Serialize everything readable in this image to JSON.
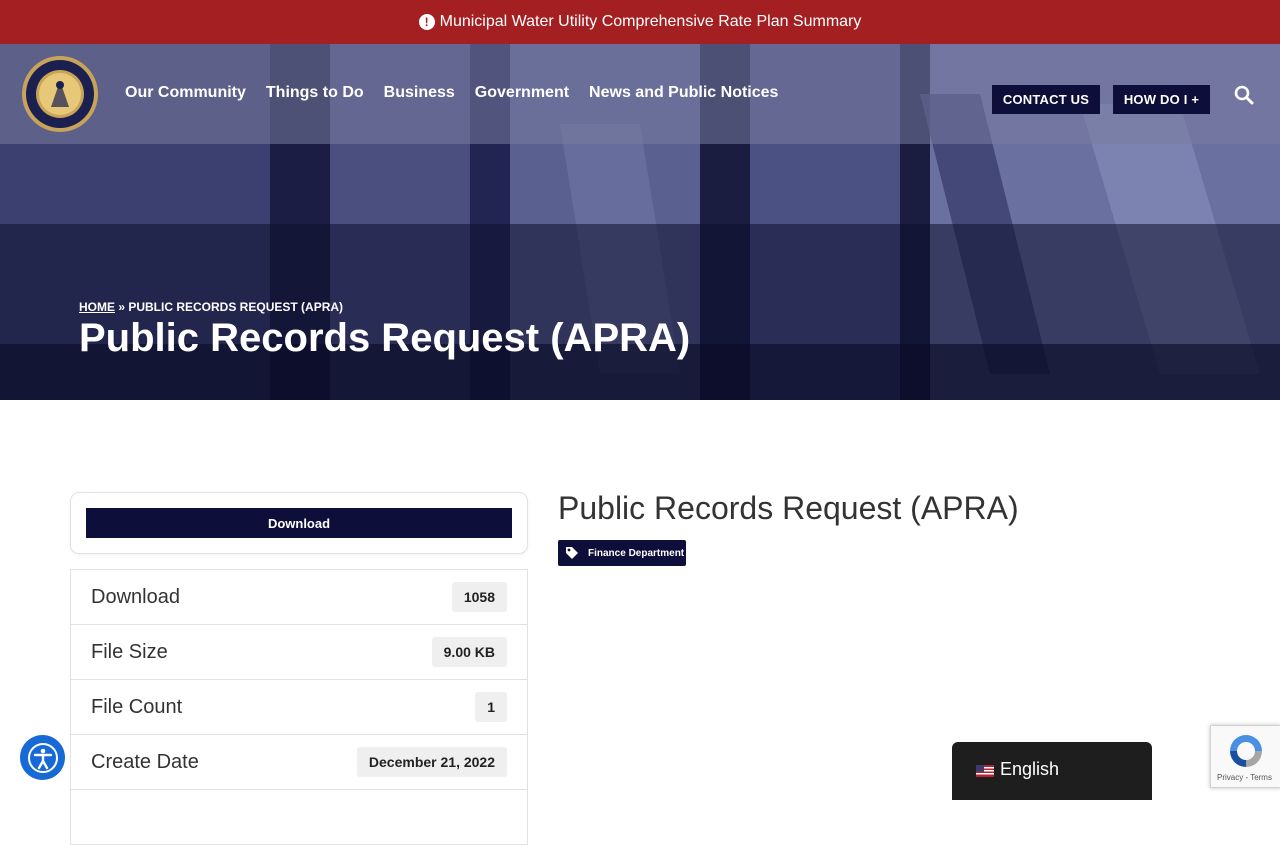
{
  "alert": {
    "icon": "exclamation-circle-icon",
    "text": "Municipal Water Utility Comprehensive Rate Plan Summary"
  },
  "header": {
    "logo": "city-of-mishawaka-seal",
    "nav": [
      {
        "label": "Our Community"
      },
      {
        "label": "Things to Do"
      },
      {
        "label": "Business"
      },
      {
        "label": "Government"
      },
      {
        "label": "News and Public Notices"
      }
    ],
    "contact_label": "CONTACT US",
    "howdoi_label": "HOW DO I +",
    "search_icon": "search-icon"
  },
  "hero": {
    "breadcrumb_home": "HOME",
    "breadcrumb_sep": " » ",
    "breadcrumb_current": "PUBLIC RECORDS REQUEST (APRA)",
    "title": "Public Records Request (APRA)"
  },
  "download_card": {
    "button_label": "Download"
  },
  "file_info": [
    {
      "label": "Download",
      "value": "1058"
    },
    {
      "label": "File Size",
      "value": "9.00 KB"
    },
    {
      "label": "File Count",
      "value": "1"
    },
    {
      "label": "Create Date",
      "value": "December 21, 2022"
    }
  ],
  "document": {
    "title": "Public Records Request (APRA)",
    "tag_icon": "tag-icon",
    "tag_label": "Finance Department"
  },
  "widgets": {
    "accessibility_icon": "accessibility-icon",
    "language_label": "English",
    "language_flag": "us-flag-icon",
    "recaptcha_links": "Privacy - Terms"
  },
  "colors": {
    "alert_red": "#a41f22",
    "navy": "#0d0e3a",
    "accessibility_blue": "#1769d6"
  }
}
